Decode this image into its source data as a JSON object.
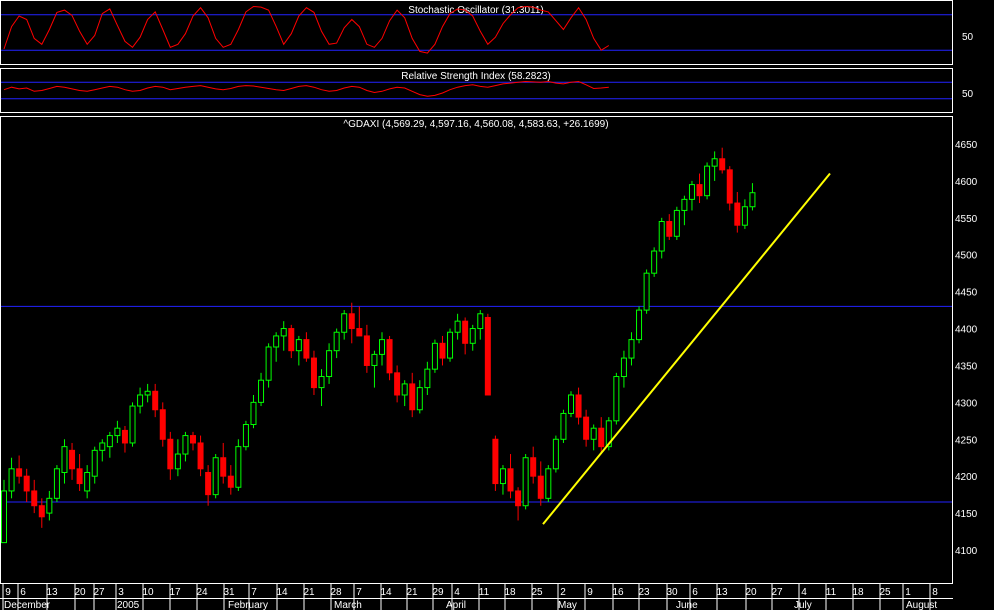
{
  "chart_data": [
    {
      "type": "line",
      "title": "Stochastic Oscillator (31.3011)",
      "ylim": [
        0,
        100
      ],
      "ytick_labels": [
        "50"
      ],
      "reference_lines": [
        80,
        20
      ],
      "series": [
        {
          "color": "#ff0000",
          "values": [
            22,
            60,
            78,
            72,
            40,
            30,
            55,
            84,
            88,
            79,
            52,
            30,
            45,
            82,
            90,
            62,
            35,
            25,
            42,
            72,
            85,
            55,
            25,
            30,
            48,
            78,
            92,
            75,
            40,
            25,
            30,
            55,
            85,
            94,
            93,
            88,
            60,
            30,
            48,
            78,
            92,
            84,
            52,
            30,
            32,
            58,
            72,
            60,
            30,
            25,
            40,
            70,
            88,
            75,
            40,
            18,
            15,
            30,
            60,
            82,
            90,
            88,
            78,
            52,
            30,
            42,
            65,
            80,
            92,
            94,
            93,
            88,
            85,
            70,
            55,
            75,
            92,
            72,
            40,
            20,
            28
          ]
        }
      ]
    },
    {
      "type": "line",
      "title": "Relative Strength Index (58.2823)",
      "ylim": [
        0,
        100
      ],
      "ytick_labels": [
        "50"
      ],
      "reference_lines": [
        70,
        30
      ],
      "series": [
        {
          "color": "#ff0000",
          "values": [
            52,
            58,
            54,
            56,
            48,
            50,
            55,
            60,
            58,
            54,
            50,
            48,
            52,
            56,
            60,
            58,
            52,
            48,
            50,
            56,
            60,
            58,
            52,
            55,
            58,
            60,
            62,
            58,
            54,
            52,
            55,
            60,
            62,
            61,
            58,
            55,
            52,
            50,
            55,
            60,
            62,
            58,
            52,
            48,
            50,
            56,
            60,
            58,
            50,
            45,
            48,
            54,
            58,
            56,
            48,
            40,
            36,
            38,
            44,
            52,
            58,
            62,
            64,
            60,
            58,
            62,
            66,
            68,
            70,
            72,
            71,
            70,
            72,
            68,
            66,
            70,
            72,
            64,
            55,
            56,
            58
          ]
        }
      ]
    },
    {
      "type": "candlestick",
      "title": "^GDAXI (4,569.29, 4,597.16, 4,560.08, 4,583.63, +26.1699)",
      "ylim": [
        4050,
        4680
      ],
      "ytick_labels": [
        "4650",
        "4600",
        "4550",
        "4500",
        "4450",
        "4400",
        "4350",
        "4300",
        "4250",
        "4200",
        "4150",
        "4100"
      ],
      "reference_lines": [
        4430,
        4165
      ],
      "trendline": {
        "start": [
          "2005-04-27",
          4135
        ],
        "end": [
          "2005-07-11",
          4610
        ],
        "color": "#ffff00"
      },
      "colors": {
        "up": "#00ff00",
        "down": "#ff0000"
      },
      "ohlc": [
        [
          4110,
          4195,
          4110,
          4180
        ],
        [
          4180,
          4225,
          4170,
          4210
        ],
        [
          4210,
          4228,
          4190,
          4200
        ],
        [
          4200,
          4210,
          4165,
          4180
        ],
        [
          4180,
          4195,
          4150,
          4160
        ],
        [
          4160,
          4170,
          4130,
          4145
        ],
        [
          4150,
          4180,
          4140,
          4170
        ],
        [
          4170,
          4215,
          4165,
          4210
        ],
        [
          4205,
          4250,
          4190,
          4240
        ],
        [
          4235,
          4245,
          4195,
          4210
        ],
        [
          4210,
          4230,
          4180,
          4190
        ],
        [
          4180,
          4215,
          4170,
          4205
        ],
        [
          4200,
          4240,
          4190,
          4235
        ],
        [
          4235,
          4250,
          4220,
          4245
        ],
        [
          4240,
          4260,
          4225,
          4255
        ],
        [
          4255,
          4275,
          4245,
          4265
        ],
        [
          4262,
          4268,
          4232,
          4245
        ],
        [
          4245,
          4300,
          4240,
          4295
        ],
        [
          4295,
          4320,
          4285,
          4310
        ],
        [
          4310,
          4325,
          4300,
          4315
        ],
        [
          4315,
          4325,
          4280,
          4290
        ],
        [
          4290,
          4300,
          4240,
          4250
        ],
        [
          4250,
          4260,
          4195,
          4210
        ],
        [
          4210,
          4250,
          4200,
          4230
        ],
        [
          4230,
          4260,
          4220,
          4255
        ],
        [
          4255,
          4260,
          4235,
          4245
        ],
        [
          4245,
          4255,
          4200,
          4210
        ],
        [
          4205,
          4215,
          4160,
          4175
        ],
        [
          4175,
          4230,
          4170,
          4225
        ],
        [
          4225,
          4245,
          4190,
          4200
        ],
        [
          4200,
          4215,
          4175,
          4185
        ],
        [
          4185,
          4250,
          4180,
          4240
        ],
        [
          4240,
          4275,
          4235,
          4270
        ],
        [
          4270,
          4310,
          4265,
          4300
        ],
        [
          4300,
          4340,
          4295,
          4330
        ],
        [
          4330,
          4380,
          4320,
          4375
        ],
        [
          4375,
          4395,
          4355,
          4390
        ],
        [
          4390,
          4410,
          4370,
          4400
        ],
        [
          4400,
          4405,
          4360,
          4370
        ],
        [
          4370,
          4390,
          4350,
          4385
        ],
        [
          4385,
          4395,
          4355,
          4360
        ],
        [
          4360,
          4370,
          4310,
          4320
        ],
        [
          4320,
          4345,
          4295,
          4335
        ],
        [
          4335,
          4380,
          4325,
          4370
        ],
        [
          4370,
          4400,
          4360,
          4395
        ],
        [
          4395,
          4425,
          4385,
          4420
        ],
        [
          4420,
          4435,
          4380,
          4400
        ],
        [
          4400,
          4430,
          4390,
          4390
        ],
        [
          4390,
          4405,
          4340,
          4350
        ],
        [
          4350,
          4370,
          4320,
          4365
        ],
        [
          4365,
          4395,
          4350,
          4385
        ],
        [
          4385,
          4390,
          4330,
          4340
        ],
        [
          4340,
          4350,
          4300,
          4310
        ],
        [
          4310,
          4330,
          4295,
          4325
        ],
        [
          4325,
          4340,
          4280,
          4290
        ],
        [
          4290,
          4330,
          4285,
          4320
        ],
        [
          4320,
          4355,
          4310,
          4345
        ],
        [
          4345,
          4385,
          4340,
          4380
        ],
        [
          4380,
          4390,
          4350,
          4360
        ],
        [
          4360,
          4400,
          4355,
          4395
        ],
        [
          4395,
          4420,
          4385,
          4410
        ],
        [
          4410,
          4415,
          4365,
          4380
        ],
        [
          4380,
          4405,
          4370,
          4400
        ],
        [
          4400,
          4425,
          4385,
          4420
        ],
        [
          4415,
          4420,
          4350,
          4310
        ],
        [
          4250,
          4255,
          4180,
          4190
        ],
        [
          4190,
          4215,
          4175,
          4210
        ],
        [
          4210,
          4230,
          4170,
          4180
        ],
        [
          4180,
          4185,
          4140,
          4160
        ],
        [
          4160,
          4230,
          4155,
          4225
        ],
        [
          4225,
          4240,
          4190,
          4200
        ],
        [
          4200,
          4220,
          4160,
          4170
        ],
        [
          4170,
          4215,
          4165,
          4210
        ],
        [
          4210,
          4255,
          4205,
          4250
        ],
        [
          4250,
          4290,
          4245,
          4285
        ],
        [
          4285,
          4315,
          4280,
          4310
        ],
        [
          4310,
          4320,
          4270,
          4280
        ],
        [
          4280,
          4290,
          4240,
          4250
        ],
        [
          4250,
          4270,
          4235,
          4265
        ],
        [
          4265,
          4280,
          4230,
          4240
        ],
        [
          4240,
          4280,
          4235,
          4275
        ],
        [
          4275,
          4340,
          4270,
          4335
        ],
        [
          4335,
          4370,
          4320,
          4360
        ],
        [
          4360,
          4395,
          4350,
          4385
        ],
        [
          4385,
          4430,
          4380,
          4425
        ],
        [
          4425,
          4480,
          4420,
          4475
        ],
        [
          4475,
          4510,
          4470,
          4505
        ],
        [
          4505,
          4550,
          4495,
          4545
        ],
        [
          4545,
          4555,
          4520,
          4525
        ],
        [
          4525,
          4565,
          4520,
          4560
        ],
        [
          4560,
          4580,
          4540,
          4575
        ],
        [
          4575,
          4600,
          4560,
          4595
        ],
        [
          4595,
          4610,
          4570,
          4580
        ],
        [
          4580,
          4625,
          4575,
          4620
        ],
        [
          4620,
          4640,
          4600,
          4630
        ],
        [
          4630,
          4645,
          4610,
          4615
        ],
        [
          4615,
          4620,
          4560,
          4570
        ],
        [
          4570,
          4585,
          4530,
          4540
        ],
        [
          4540,
          4575,
          4535,
          4565
        ],
        [
          4565,
          4597,
          4560,
          4584
        ]
      ]
    }
  ],
  "x_axis": {
    "ticks": [
      "9",
      "6",
      "13",
      "20",
      "27",
      "3",
      "10",
      "17",
      "24",
      "31",
      "7",
      "14",
      "21",
      "28",
      "7",
      "14",
      "21",
      "29",
      "4",
      "11",
      "18",
      "25",
      "2",
      "9",
      "16",
      "23",
      "30",
      "6",
      "13",
      "20",
      "27",
      "4",
      "11",
      "18",
      "25",
      "1",
      "8"
    ],
    "months": [
      "December",
      "2005",
      "February",
      "March",
      "April",
      "May",
      "June",
      "July",
      "August"
    ]
  }
}
